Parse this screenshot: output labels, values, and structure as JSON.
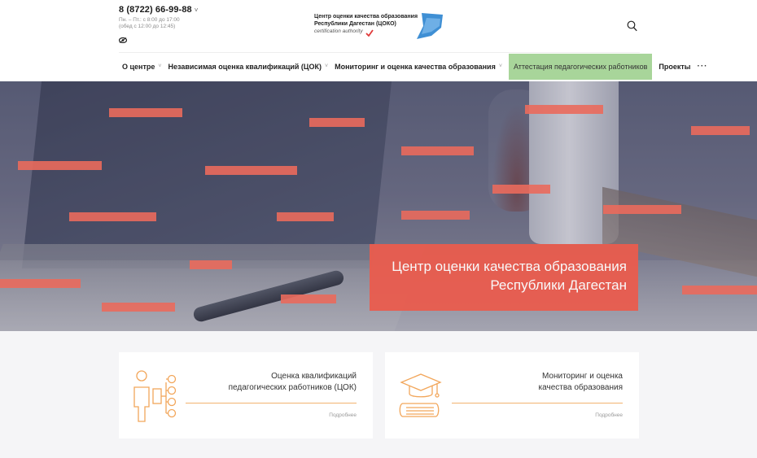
{
  "header": {
    "phone": "8 (8722) 66-99-88",
    "phone_caret": "˅",
    "hours_line1": "Пн. – Пт.: с 8:00 до 17:00",
    "hours_line2": "(обед с 12:00 до 12:45)",
    "logo_line1": "Центр оценки качества образования",
    "logo_line2": "Республики Дагестан (ЦОКО)",
    "logo_sub": "certification authority",
    "check_color": "#e03a3a",
    "accent_blue": "#3f8fd4"
  },
  "nav": {
    "items": [
      {
        "label": "О центре",
        "has_dropdown": true
      },
      {
        "label": "Независимая оценка квалификаций (ЦОК)",
        "has_dropdown": true
      },
      {
        "label": "Мониторинг и оценка качества образования",
        "has_dropdown": true
      },
      {
        "label": "Аттестация педагогических работников",
        "has_dropdown": false,
        "active": true
      },
      {
        "label": "Проекты",
        "has_dropdown": false
      }
    ],
    "chevron": "˅",
    "more": "···",
    "active_color": "#a8d59a"
  },
  "hero": {
    "title_line1": "Центр оценки качества образования",
    "title_line2": "Республики Дагестан",
    "accent_color": "#ea5c4e"
  },
  "cards": [
    {
      "title_line1": "Оценка квалификаций",
      "title_line2": "педагогических работников (ЦОК)",
      "more": "Подробнее",
      "icon": "org-structure-icon"
    },
    {
      "title_line1": "Мониторинг и оценка",
      "title_line2": "качества образования",
      "more": "Подробнее",
      "icon": "graduation-book-icon"
    }
  ],
  "icon_color": "#f2a65a"
}
